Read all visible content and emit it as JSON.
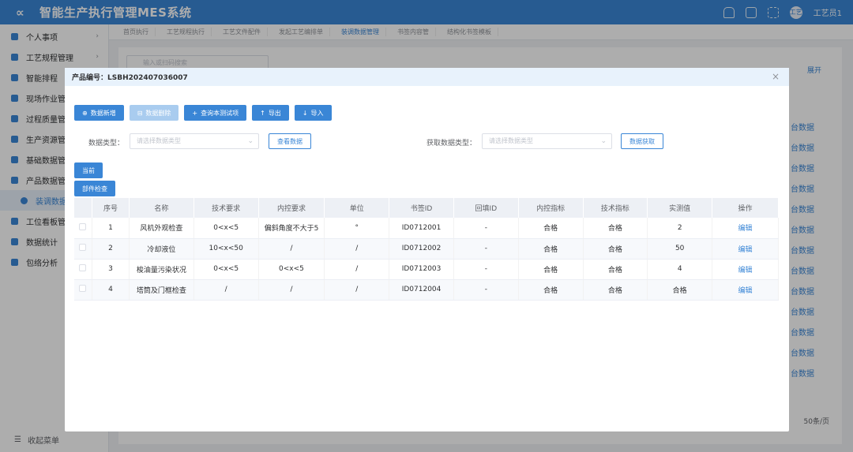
{
  "app": {
    "title": "智能生产执行管理MES系统",
    "user": "工艺员1",
    "avatar_text": "工艺"
  },
  "sidebar": {
    "items": [
      {
        "label": "个人事项"
      },
      {
        "label": "工艺规程管理"
      },
      {
        "label": "智能排程"
      },
      {
        "label": "现场作业管"
      },
      {
        "label": "过程质量管"
      },
      {
        "label": "生产资源管"
      },
      {
        "label": "基础数据管"
      },
      {
        "label": "产品数据管"
      },
      {
        "label": "装调数据"
      },
      {
        "label": "工位看板管"
      },
      {
        "label": "数据统计"
      },
      {
        "label": "包络分析"
      }
    ],
    "collapse_label": "收起菜单"
  },
  "tabs": [
    "首页执行",
    "工艺规程执行",
    "工艺文件配件",
    "发起工艺编排单",
    "装调数据管理",
    "书签内容管",
    "结构化书签模板"
  ],
  "background": {
    "search_placeholder": "输入或扫码搜索",
    "expand_label": "展开",
    "pager_label": "50条/页"
  },
  "modal": {
    "title": "产品编号：LSBH202407036007",
    "buttons": {
      "add": "数据新增",
      "del": "数据删除",
      "query_tech": "查询本测试项",
      "export": "导出",
      "import": "导入"
    },
    "filter": {
      "type_label": "数据类型：",
      "type_placeholder": "请选择数据类型",
      "view_button": "查看数据",
      "fetch_label": "获取数据类型：",
      "fetch_placeholder": "请选择数据类型",
      "fetch_button": "数据获取"
    },
    "sub_buttons": {
      "current": "当前",
      "inspect": "部件检查"
    },
    "table": {
      "headers": [
        "",
        "序号",
        "名称",
        "技术要求",
        "内控要求",
        "单位",
        "书签ID",
        "回填ID",
        "内控指标",
        "技术指标",
        "实测值",
        "操作"
      ],
      "rows": [
        {
          "no": "1",
          "name": "风机外观检查",
          "tech": "0<x<5",
          "inner": "偏斜角度不大于5",
          "unit": "°",
          "bid": "ID0712001",
          "fid": "-",
          "inner_idx": "合格",
          "tech_idx": "合格",
          "val": "2",
          "op": "编辑"
        },
        {
          "no": "2",
          "name": "冷却液位",
          "tech": "10<x<50",
          "inner": "/",
          "unit": "/",
          "bid": "ID0712002",
          "fid": "-",
          "inner_idx": "合格",
          "tech_idx": "合格",
          "val": "50",
          "op": "编辑"
        },
        {
          "no": "3",
          "name": "梭油量污染状况",
          "tech": "0<x<5",
          "inner": "0<x<5",
          "unit": "/",
          "bid": "ID0712003",
          "fid": "-",
          "inner_idx": "合格",
          "tech_idx": "合格",
          "val": "4",
          "op": "编辑"
        },
        {
          "no": "4",
          "name": "塔筒及门框检查",
          "tech": "/",
          "inner": "/",
          "unit": "/",
          "bid": "ID0712004",
          "fid": "-",
          "inner_idx": "合格",
          "tech_idx": "合格",
          "val": "合格",
          "op": "编辑"
        }
      ]
    }
  },
  "right_col": [
    "台数据",
    "台数据",
    "台数据",
    "台数据",
    "台数据",
    "台数据",
    "台数据",
    "台数据",
    "台数据",
    "台数据",
    "台数据",
    "台数据",
    "台数据"
  ]
}
